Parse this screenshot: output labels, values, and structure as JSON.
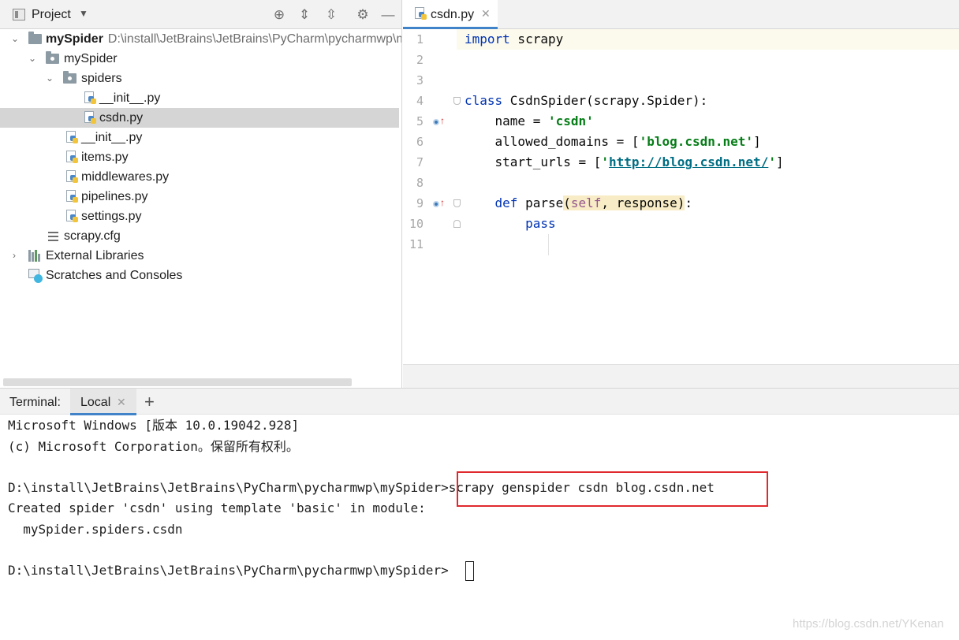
{
  "project": {
    "header_title": "Project",
    "tree": {
      "root_name": "mySpider",
      "root_path": "D:\\install\\JetBrains\\JetBrains\\PyCharm\\pycharmwp\\mySpider",
      "pkg_name": "mySpider",
      "spiders_name": "spiders",
      "spiders_init": "__init__.py",
      "csdn_file": "csdn.py",
      "pkg_init": "__init__.py",
      "items": "items.py",
      "middlewares": "middlewares.py",
      "pipelines": "pipelines.py",
      "settings": "settings.py",
      "scrapy_cfg": "scrapy.cfg",
      "external_libraries": "External Libraries",
      "scratches": "Scratches and Consoles"
    }
  },
  "editor": {
    "tab_label": "csdn.py",
    "line_numbers": [
      "1",
      "2",
      "3",
      "4",
      "5",
      "6",
      "7",
      "8",
      "9",
      "10",
      "11"
    ],
    "code": {
      "l1_kw": "import",
      "l1_rest": " scrapy",
      "l4_kw": "class",
      "l4_rest": " CsdnSpider(scrapy.Spider):",
      "l5_pre": "    name = ",
      "l5_str": "'csdn'",
      "l6_pre": "    allowed_domains = [",
      "l6_str": "'blog.csdn.net'",
      "l6_post": "]",
      "l7_pre": "    start_urls = [",
      "l7_q1": "'",
      "l7_url": "http://blog.csdn.net/",
      "l7_q2": "'",
      "l7_post": "]",
      "l9_kw": "    def",
      "l9_fn": " parse",
      "l9_open": "(",
      "l9_self": "self",
      "l9_args": ", response",
      "l9_close": ")",
      "l9_colon": ":",
      "l10_kw": "        pass"
    }
  },
  "terminal": {
    "label": "Terminal:",
    "tab_label": "Local",
    "lines": {
      "l1": "Microsoft Windows [版本 10.0.19042.928]",
      "l2": "(c) Microsoft Corporation。保留所有权利。",
      "l3_prompt": "D:\\install\\JetBrains\\JetBrains\\PyCharm\\pycharmwp\\mySpider>",
      "l3_cmd": "scrapy genspider csdn blog.csdn.net",
      "l4": "Created spider 'csdn' using template 'basic' in module:",
      "l5": "  mySpider.spiders.csdn",
      "l6_prompt": "D:\\install\\JetBrains\\JetBrains\\PyCharm\\pycharmwp\\mySpider>"
    },
    "watermark": "https://blog.csdn.net/YKenan"
  },
  "colors": {
    "accent": "#4083c9",
    "selection": "#d5d5d5",
    "highlight_box": "#e0292e",
    "keyword": "#0033b3",
    "string": "#067d17"
  }
}
